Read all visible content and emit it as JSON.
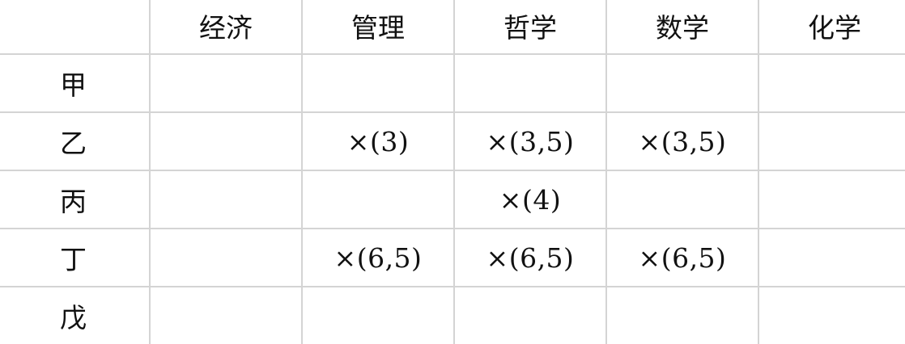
{
  "table": {
    "corner": "",
    "columns": [
      "经济",
      "管理",
      "哲学",
      "数学",
      "化学"
    ],
    "rows": [
      {
        "label": "甲",
        "cells": [
          "",
          "",
          "",
          "",
          ""
        ]
      },
      {
        "label": "乙",
        "cells": [
          "",
          "×(3)",
          "×(3,5)",
          "×(3,5)",
          ""
        ]
      },
      {
        "label": "丙",
        "cells": [
          "",
          "",
          "×(4)",
          "",
          ""
        ]
      },
      {
        "label": "丁",
        "cells": [
          "",
          "×(6,5)",
          "×(6,5)",
          "×(6,5)",
          ""
        ]
      },
      {
        "label": "戊",
        "cells": [
          "",
          "",
          "",
          "",
          ""
        ]
      }
    ]
  }
}
